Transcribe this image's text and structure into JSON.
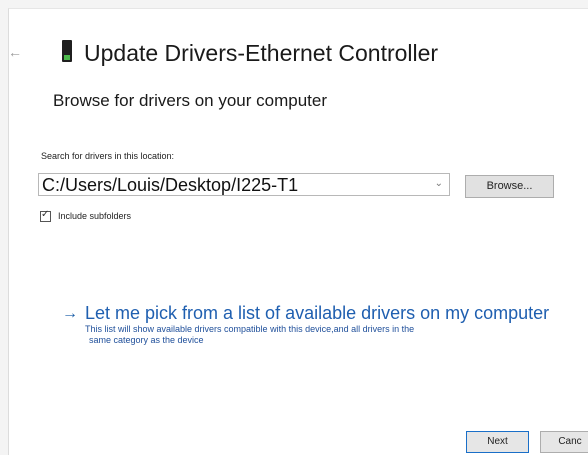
{
  "header": {
    "back_icon": "back-arrow-icon",
    "device_icon": "network-adapter-icon",
    "title": "Update Drivers-Ethernet Controller"
  },
  "subtitle": "Browse for drivers on your computer",
  "search": {
    "label": "Search for drivers in this location:",
    "path_value": "C:/Users/Louis/Desktop/I225-T1",
    "dropdown_icon": "chevron-down-icon",
    "browse_label": "Browse...",
    "include_subfolders_label": "Include subfolders",
    "include_subfolders_checked": true
  },
  "pick": {
    "arrow_icon": "right-arrow-icon",
    "link_text": "Let me pick from a list of available drivers on my computer",
    "description_line1": "This list will show available drivers compatible with this device,and all drivers in the",
    "description_line2": "same category as the device"
  },
  "footer": {
    "next_label": "Next",
    "cancel_label": "Canc"
  },
  "colors": {
    "link": "#1f5fb0",
    "primary_border": "#1a6fc8",
    "button_bg": "#e1e1e1"
  }
}
